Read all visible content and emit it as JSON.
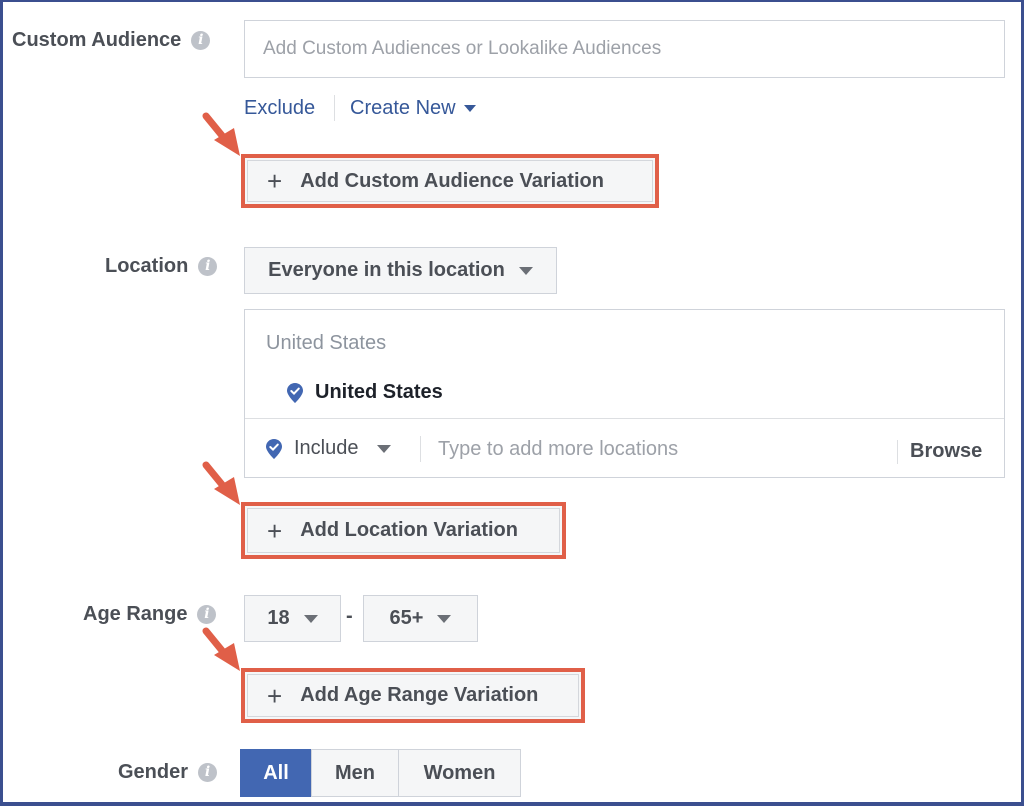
{
  "custom_audience": {
    "label": "Custom Audience",
    "placeholder": "Add Custom Audiences or Lookalike Audiences",
    "exclude_link": "Exclude",
    "create_new_link": "Create New",
    "variation_button": "Add Custom Audience Variation"
  },
  "location": {
    "label": "Location",
    "mode_select": "Everyone in this location",
    "group_header": "United States",
    "selected_item": "United States",
    "include_select": "Include",
    "search_placeholder": "Type to add more locations",
    "browse_button": "Browse",
    "variation_button": "Add Location Variation"
  },
  "age_range": {
    "label": "Age Range",
    "min": "18",
    "separator": "-",
    "max": "65+",
    "variation_button": "Add Age Range Variation"
  },
  "gender": {
    "label": "Gender",
    "options": [
      "All",
      "Men",
      "Women"
    ],
    "selected": "All"
  },
  "colors": {
    "link": "#365899",
    "highlight": "#e05f48",
    "active": "#4267b2",
    "frame": "#3b4f8f"
  },
  "icons": [
    "info-icon",
    "chevron-down-icon",
    "plus-icon",
    "location-pin-icon",
    "red-arrow-icon"
  ]
}
